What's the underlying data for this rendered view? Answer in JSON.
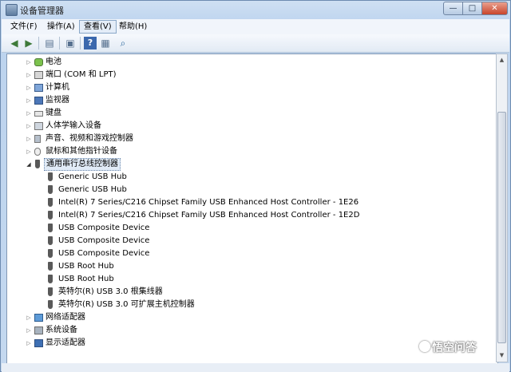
{
  "window": {
    "title": "设备管理器"
  },
  "caption_buttons": {
    "minimize": "—",
    "maximize": "□",
    "close": "✕"
  },
  "menu": [
    {
      "label": "文件(F)"
    },
    {
      "label": "操作(A)"
    },
    {
      "label": "查看(V)"
    },
    {
      "label": "帮助(H)"
    }
  ],
  "toolbar": {
    "buttons": [
      "back-icon",
      "forward-icon",
      "show-hide-console-icon",
      "properties-icon",
      "help-icon",
      "view-icon",
      "scan-hardware-icon"
    ]
  },
  "tree": {
    "categories": [
      {
        "label": "电池",
        "icon": "battery-icon",
        "expanded": false
      },
      {
        "label": "端口 (COM 和 LPT)",
        "icon": "port-icon",
        "expanded": false
      },
      {
        "label": "计算机",
        "icon": "computer-icon",
        "expanded": false
      },
      {
        "label": "监视器",
        "icon": "monitor-icon",
        "expanded": false
      },
      {
        "label": "键盘",
        "icon": "keyboard-icon",
        "expanded": false
      },
      {
        "label": "人体学输入设备",
        "icon": "hid-icon",
        "expanded": false
      },
      {
        "label": "声音、视频和游戏控制器",
        "icon": "sound-icon",
        "expanded": false
      },
      {
        "label": "鼠标和其他指针设备",
        "icon": "mouse-icon",
        "expanded": false
      },
      {
        "label": "通用串行总线控制器",
        "icon": "usb-icon",
        "expanded": true,
        "selected": true
      }
    ],
    "usb_children": [
      {
        "label": "Generic USB Hub"
      },
      {
        "label": "Generic USB Hub"
      },
      {
        "label": "Intel(R) 7 Series/C216 Chipset Family USB Enhanced Host Controller - 1E26"
      },
      {
        "label": "Intel(R) 7 Series/C216 Chipset Family USB Enhanced Host Controller - 1E2D"
      },
      {
        "label": "USB Composite Device"
      },
      {
        "label": "USB Composite Device"
      },
      {
        "label": "USB Composite Device"
      },
      {
        "label": "USB Root Hub"
      },
      {
        "label": "USB Root Hub"
      },
      {
        "label": "英特尔(R) USB 3.0 根集线器"
      },
      {
        "label": "英特尔(R) USB 3.0 可扩展主机控制器"
      }
    ],
    "after": [
      {
        "label": "网络适配器",
        "icon": "network-icon",
        "expanded": false
      },
      {
        "label": "系统设备",
        "icon": "system-icon",
        "expanded": false
      },
      {
        "label": "显示适配器",
        "icon": "display-icon",
        "expanded": false
      }
    ]
  },
  "watermark": {
    "text": "悟空问答"
  }
}
